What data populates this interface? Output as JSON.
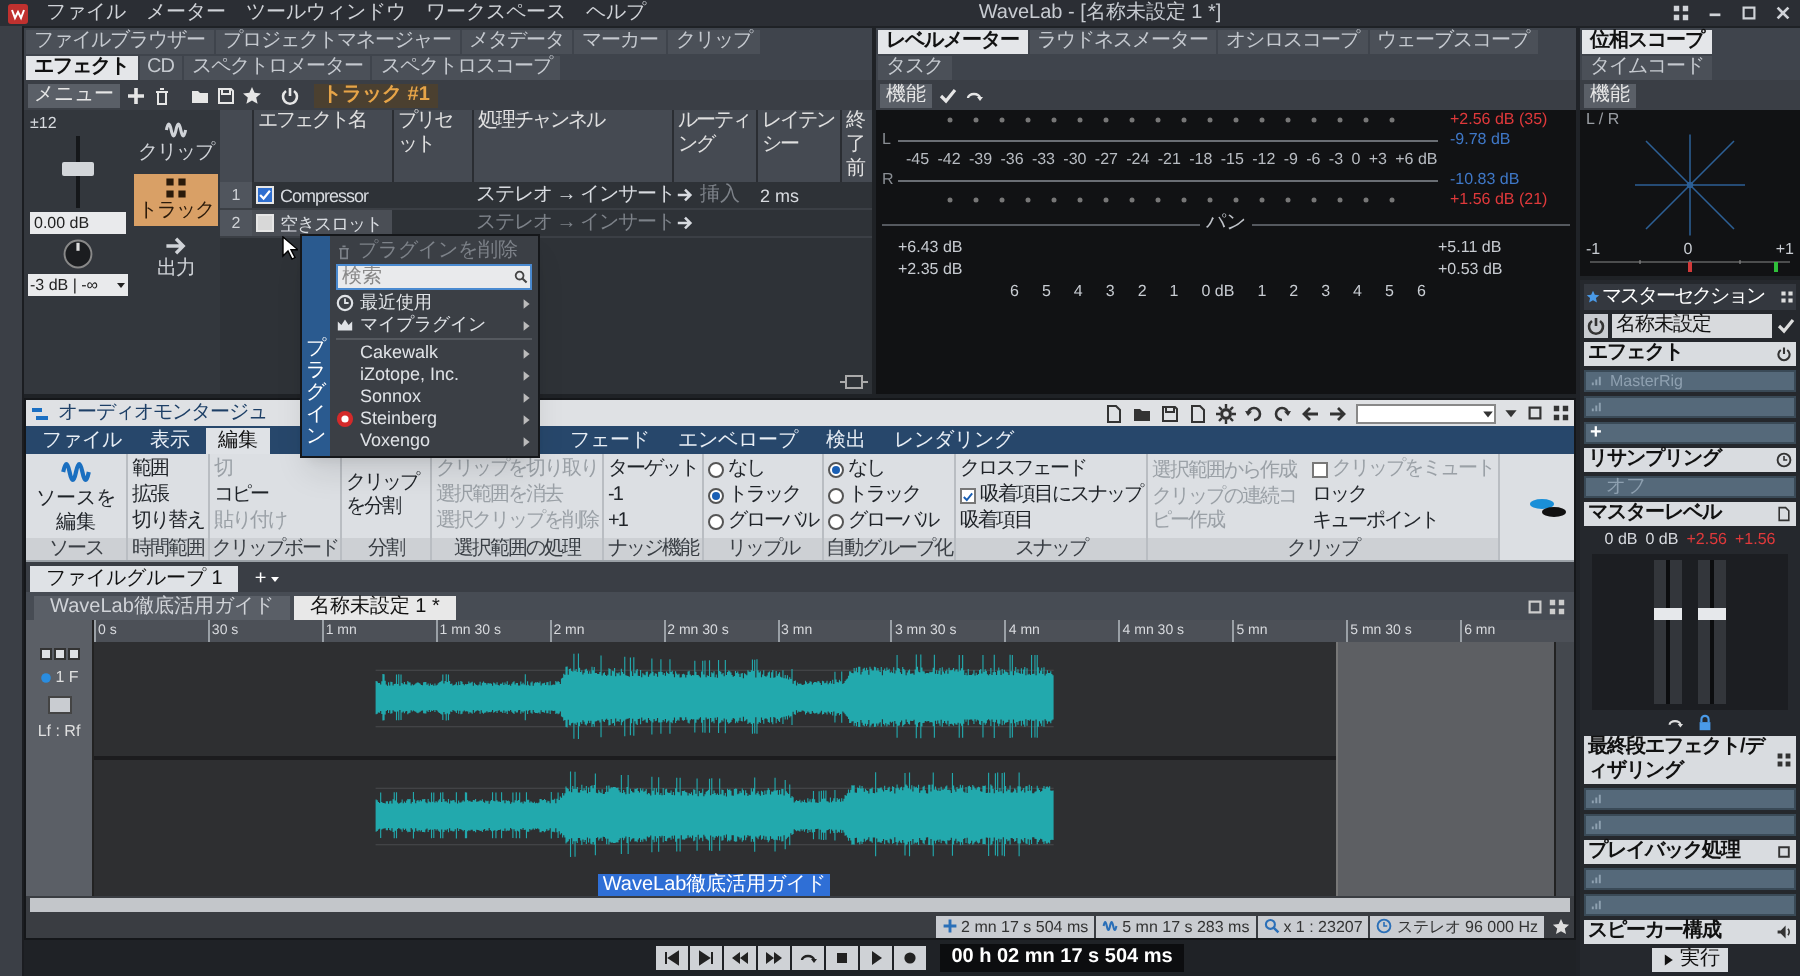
{
  "title_bar": {
    "menu": [
      "ファイル",
      "メーター",
      "ツールウィンドウ",
      "ワークスペース",
      "ヘルプ"
    ],
    "title": "WaveLab - [名称未設定 1 *]"
  },
  "effects_pane": {
    "tabs": [
      {
        "label": "ファイルブラウザー",
        "selected": false
      },
      {
        "label": "プロジェクトマネージャー",
        "selected": false
      },
      {
        "label": "メタデータ",
        "selected": false
      },
      {
        "label": "マーカー",
        "selected": false
      },
      {
        "label": "クリップ",
        "selected": false
      },
      {
        "label": "エフェクト",
        "selected": true
      },
      {
        "label": "CD",
        "selected": false
      },
      {
        "label": "スペクトロメーター",
        "selected": false
      },
      {
        "label": "スペクトロスコープ",
        "selected": false
      }
    ],
    "menu_button": "メニュー",
    "track_label": "トラック #1",
    "gain_range": "±12",
    "fader": {
      "level": 0.55
    },
    "gain_value": "0.00 dB",
    "pan_law": "-3 dB | -∞",
    "modes": [
      {
        "label": "クリップ",
        "selected": false
      },
      {
        "label": "トラック",
        "selected": true
      },
      {
        "label": "出力",
        "selected": false
      }
    ],
    "columns": [
      "エフェクト名",
      "プリセット",
      "処理チャンネル",
      "ルーティング",
      "レイテンシー",
      "終了前"
    ],
    "rows": [
      {
        "slot": "1",
        "checked": true,
        "name": "Compressor",
        "channels": "ステレオ → インサート",
        "routing": "挿入",
        "latency": "2 ms"
      },
      {
        "slot": "2",
        "checked": false,
        "name": "空きスロット",
        "channels": "ステレオ → インサート"
      }
    ]
  },
  "plugin_menu": {
    "side_label": "プラグイン",
    "remove": "プラグインを削除",
    "search_placeholder": "検索",
    "items": [
      {
        "label": "最近使用"
      },
      {
        "label": "マイプラグイン"
      },
      {
        "label": "Cakewalk"
      },
      {
        "label": "iZotope, Inc."
      },
      {
        "label": "Sonnox"
      },
      {
        "label": "Steinberg"
      },
      {
        "label": "Voxengo"
      }
    ]
  },
  "meters": {
    "tabs": [
      {
        "label": "レベルメーター",
        "selected": true
      },
      {
        "label": "ラウドネスメーター",
        "selected": false
      },
      {
        "label": "オシロスコープ",
        "selected": false
      },
      {
        "label": "ウェーブスコープ",
        "selected": false
      },
      {
        "label": "タスク",
        "selected": false
      }
    ],
    "function_button": "機能",
    "channels": [
      "L",
      "R"
    ],
    "scale": [
      "-45",
      "-42",
      "-39",
      "-36",
      "-33",
      "-30",
      "-27",
      "-24",
      "-21",
      "-18",
      "-15",
      "-12",
      "-9",
      "-6",
      "-3",
      "0",
      "+3",
      "+6 dB"
    ],
    "readings": [
      {
        "text": "+2.56 dB (35)",
        "kind": "peak"
      },
      {
        "text": "-9.78 dB",
        "kind": "rms"
      },
      {
        "text": "-10.83 dB",
        "kind": "rms"
      },
      {
        "text": "+1.56 dB (21)",
        "kind": "peak"
      }
    ],
    "pan_label": "パン",
    "pan_left": [
      "+6.43 dB",
      "+2.35 dB"
    ],
    "pan_right": [
      "+5.11 dB",
      "+0.53 dB"
    ],
    "pan_scale": [
      "6",
      "5",
      "4",
      "3",
      "2",
      "1",
      "0 dB",
      "1",
      "2",
      "3",
      "4",
      "5",
      "6"
    ]
  },
  "phase_scope": {
    "tabs": [
      {
        "label": "位相スコープ",
        "selected": true
      },
      {
        "label": "タイムコード",
        "selected": false
      }
    ],
    "function_button": "機能",
    "axis_label": "L / R",
    "scale": [
      "-1",
      "0",
      "+1"
    ]
  },
  "montage": {
    "title": "オーディオモンタージュ",
    "tabs": [
      {
        "label": "ファイル",
        "selected": false
      },
      {
        "label": "表示",
        "selected": false
      },
      {
        "label": "編集",
        "selected": true
      },
      {
        "label": "フェード",
        "selected": false
      },
      {
        "label": "エンベロープ",
        "selected": false
      },
      {
        "label": "検出",
        "selected": false
      },
      {
        "label": "レンダリング",
        "selected": false
      }
    ],
    "groups": [
      {
        "label": "ソース",
        "columns": [
          [
            {
              "kind": "big",
              "label": "ソースを編集",
              "disabled": false
            }
          ]
        ]
      },
      {
        "label": "時間範囲",
        "columns": [
          [
            {
              "kind": "button",
              "label": "範囲",
              "disabled": false
            },
            {
              "kind": "button",
              "label": "拡張",
              "disabled": false
            },
            {
              "kind": "button",
              "label": "切り替え",
              "disabled": false
            }
          ]
        ]
      },
      {
        "label": "クリップボード",
        "columns": [
          [
            {
              "kind": "button",
              "label": "切",
              "disabled": true
            },
            {
              "kind": "button",
              "label": "コピー",
              "disabled": false
            },
            {
              "kind": "button",
              "label": "貼り付け",
              "disabled": true
            }
          ]
        ]
      },
      {
        "label": "分割",
        "columns": [
          [
            {
              "kind": "button",
              "label": "クリップを分割",
              "disabled": false
            }
          ]
        ]
      },
      {
        "label": "選択範囲の処理",
        "columns": [
          [
            {
              "kind": "button",
              "label": "クリップを切り取り",
              "disabled": true
            },
            {
              "kind": "button",
              "label": "選択範囲を消去",
              "disabled": true
            },
            {
              "kind": "button",
              "label": "選択クリップを削除",
              "disabled": true
            }
          ]
        ]
      },
      {
        "label": "ナッジ機能",
        "columns": [
          [
            {
              "kind": "button",
              "label": "ターゲット",
              "disabled": false
            },
            {
              "kind": "button",
              "label": "-1",
              "disabled": false
            },
            {
              "kind": "button",
              "label": "+1",
              "disabled": false
            }
          ]
        ]
      },
      {
        "label": "リップル",
        "columns": [
          [
            {
              "kind": "radio",
              "label": "なし",
              "selected": false
            },
            {
              "kind": "radio",
              "label": "トラック",
              "selected": true
            },
            {
              "kind": "radio",
              "label": "グローバル",
              "selected": false
            }
          ]
        ]
      },
      {
        "label": "自動グループ化",
        "columns": [
          [
            {
              "kind": "radio",
              "label": "なし",
              "selected": true
            },
            {
              "kind": "radio",
              "label": "トラック",
              "selected": false
            },
            {
              "kind": "radio",
              "label": "グローバル",
              "selected": false
            }
          ]
        ]
      },
      {
        "label": "スナップ",
        "columns": [
          [
            {
              "kind": "button",
              "label": "クロスフェード",
              "disabled": false
            },
            {
              "kind": "check",
              "label": "吸着項目にスナップ",
              "checked": true,
              "disabled": false
            },
            {
              "kind": "button",
              "label": "吸着項目",
              "disabled": false
            }
          ]
        ]
      },
      {
        "label": "クリップ",
        "columns": [
          [
            {
              "kind": "button",
              "label": "選択範囲から作成",
              "disabled": true
            },
            {
              "kind": "button",
              "label": "クリップの連続コピー作成",
              "disabled": true
            }
          ],
          [
            {
              "kind": "check",
              "label": "クリップをミュート",
              "checked": false,
              "disabled": true
            },
            {
              "kind": "button",
              "label": "ロック",
              "disabled": false
            },
            {
              "kind": "button",
              "label": "キューポイント",
              "disabled": false
            }
          ]
        ]
      }
    ],
    "file_groups": [
      {
        "label": "ファイルグループ 1",
        "selected": true
      }
    ],
    "add_button": "+",
    "documents": [
      {
        "label": "WaveLab徹底活用ガイド",
        "selected": false
      },
      {
        "label": "名称未設定 1 *",
        "selected": true
      }
    ],
    "ruler": [
      "0 s",
      "30 s",
      "1 mn",
      "1 mn 30 s",
      "2 mn",
      "2 mn 30 s",
      "3 mn",
      "3 mn 30 s",
      "4 mn",
      "4 mn 30 s",
      "5 mn",
      "5 mn 30 s",
      "6 mn"
    ],
    "track": {
      "number": "1 F",
      "channels": "Lf : Rf"
    },
    "clip_label": "WaveLab徹底活用ガイド",
    "status": [
      "2 mn 17 s 504 ms",
      "5 mn 17 s 283 ms",
      "x 1 : 23207",
      "ステレオ 96 000 Hz"
    ]
  },
  "transport": {
    "time": "00 h 02 mn 17 s 504 ms"
  },
  "master": {
    "title": "マスターセクション",
    "preset": "名称未設定",
    "effects_title": "エフェクト",
    "effect_slots": [
      {
        "kind": "plugin",
        "label": "MasterRig"
      },
      {
        "kind": "empty"
      },
      {
        "kind": "add",
        "label": "+"
      }
    ],
    "resampling_title": "リサンプリング",
    "resampling_value": "オフ",
    "level_title": "マスターレベル",
    "level_values": [
      "0 dB",
      "0 dB"
    ],
    "peak_values": [
      "+2.56",
      "+1.56"
    ],
    "faders": [
      {
        "level": 0.62
      },
      {
        "level": 0.62
      }
    ],
    "final_title": "最終段エフェクト/ディザリング",
    "playback_title": "プレイバック処理",
    "speaker_title": "スピーカー構成",
    "run_button": "実行"
  }
}
